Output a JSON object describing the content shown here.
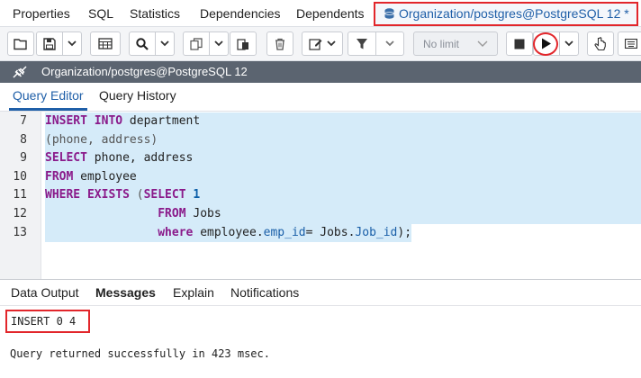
{
  "top_tabs": [
    {
      "label": "Properties"
    },
    {
      "label": "SQL"
    },
    {
      "label": "Statistics"
    },
    {
      "label": "Dependencies"
    },
    {
      "label": "Dependents"
    },
    {
      "label": "Organization/postgres@PostgreSQL 12 *",
      "active": true
    }
  ],
  "toolbar": {
    "limit_select": "No limit",
    "icons": [
      "open-file-icon",
      "save-icon",
      "chevron-down-icon",
      "grid-icon",
      "search-icon",
      "chevron-down-icon",
      "copy-icon",
      "paste-icon",
      "delete-icon",
      "edit-icon",
      "chevron-down-icon",
      "filter-icon",
      "chevron-down-icon",
      "stop-icon",
      "execute-icon",
      "chevron-down-icon",
      "pointer-icon",
      "keyboard-icon"
    ]
  },
  "connection": {
    "title": "Organization/postgres@PostgreSQL 12"
  },
  "editor_tabs": [
    {
      "label": "Query Editor",
      "active": true
    },
    {
      "label": "Query History"
    }
  ],
  "editor": {
    "line_numbers": [
      "7",
      "8",
      "9",
      "10",
      "11",
      "12",
      "13"
    ],
    "lines": {
      "l7": {
        "kw": "INSERT INTO",
        "rest": " department"
      },
      "l8": {
        "rest": "(phone, address)"
      },
      "l9": {
        "kw": "SELECT",
        "rest": " phone, address"
      },
      "l10": {
        "kw": "FROM",
        "rest": " employee"
      },
      "l11": {
        "kw": "WHERE EXISTS",
        "p1": " (",
        "kw2": "SELECT",
        "num": " 1"
      },
      "l12": {
        "indent": "                ",
        "kw": "FROM",
        "rest": " Jobs"
      },
      "l13": {
        "indent": "                ",
        "kw": "where",
        "t1": " employee.",
        "prop1": "emp_id",
        "t2": "= Jobs.",
        "prop2": "Job_id",
        "t3": ");"
      }
    }
  },
  "results": {
    "tabs": [
      {
        "label": "Data Output"
      },
      {
        "label": "Messages",
        "active": true
      },
      {
        "label": "Explain"
      },
      {
        "label": "Notifications"
      }
    ],
    "result_line": "INSERT 0 4",
    "success_line": "Query returned successfully in 423 msec."
  },
  "colors": {
    "accent_blue": "#1f5fa8",
    "highlight_red": "#e2262b",
    "selection": "#d5ebf9",
    "connbar": "#5b6470"
  }
}
